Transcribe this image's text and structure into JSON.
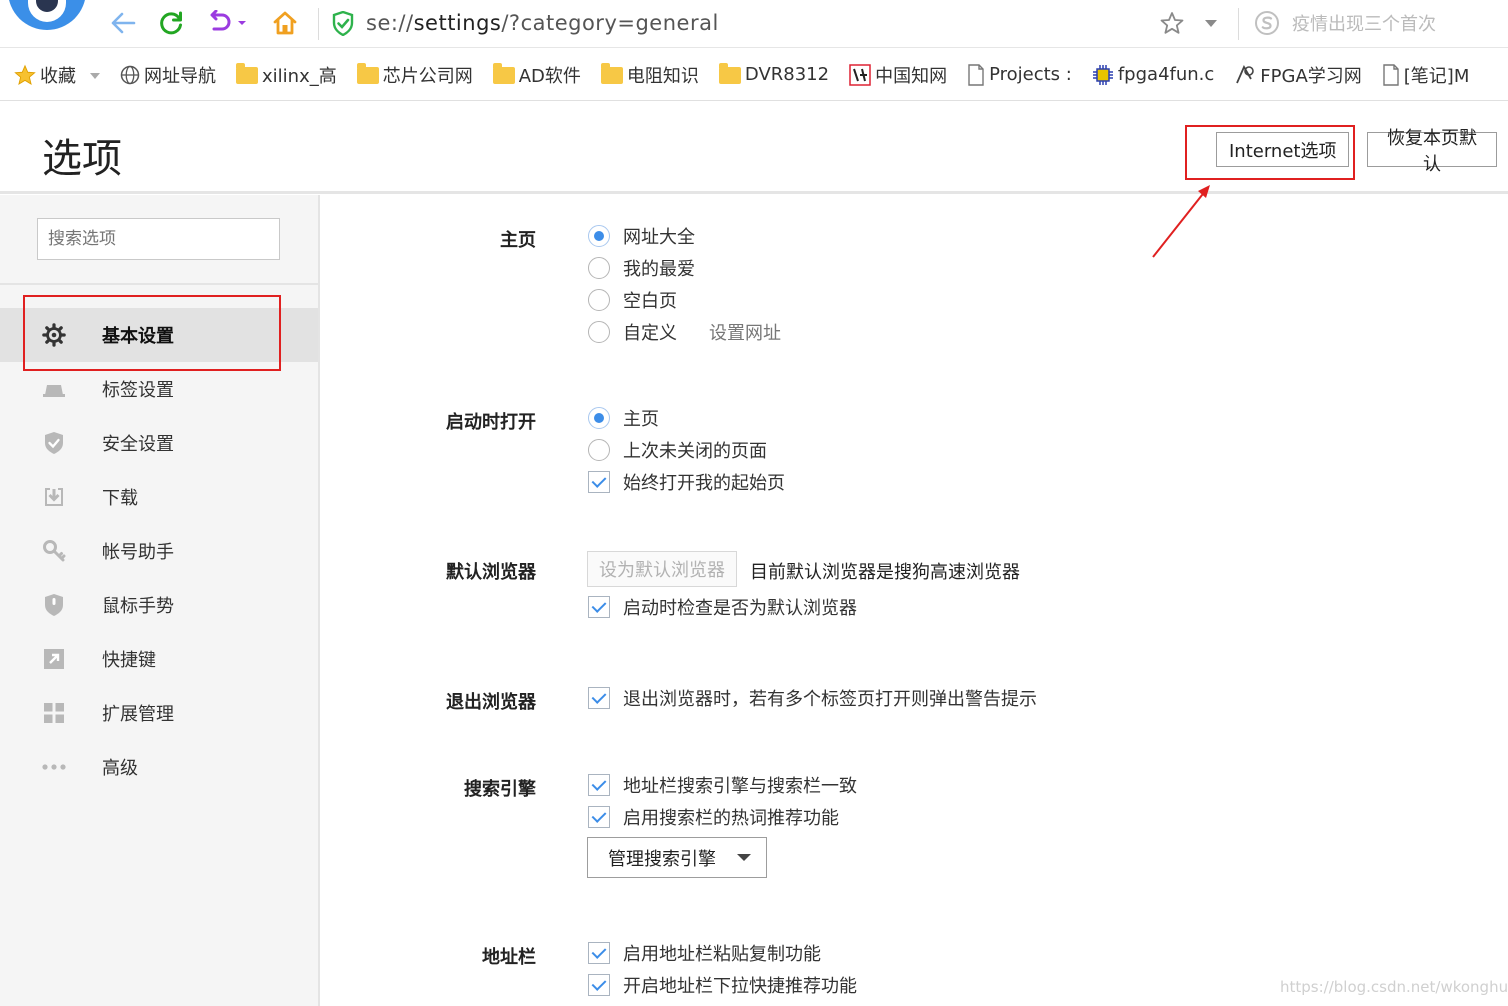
{
  "toolbar": {
    "url_prefix": "se://",
    "url_main": "settings",
    "url_suffix": "/?category=general",
    "search_placeholder": "疫情出现三个首次"
  },
  "bookmarks": [
    {
      "label": "收藏",
      "icon": "star-icon"
    },
    {
      "label": "网址导航",
      "icon": "globe-icon"
    },
    {
      "label": "xilinx_高",
      "icon": "folder-icon"
    },
    {
      "label": "芯片公司网",
      "icon": "folder-icon"
    },
    {
      "label": "AD软件",
      "icon": "folder-icon"
    },
    {
      "label": "电阻知识",
      "icon": "folder-icon"
    },
    {
      "label": "DVR8312",
      "icon": "folder-icon"
    },
    {
      "label": "中国知网",
      "icon": "cnki-icon"
    },
    {
      "label": "Projects :",
      "icon": "page-icon"
    },
    {
      "label": "fpga4fun.c",
      "icon": "chip-icon"
    },
    {
      "label": "FPGA学习网",
      "icon": "fpga-icon"
    },
    {
      "label": "[笔记]M",
      "icon": "page-icon"
    }
  ],
  "header": {
    "title": "选项",
    "internet_options_label": "Internet选项",
    "restore_defaults_label": "恢复本页默认"
  },
  "sidebar": {
    "search_placeholder": "搜索选项",
    "items": [
      {
        "label": "基本设置",
        "icon": "gear-icon",
        "active": true
      },
      {
        "label": "标签设置",
        "icon": "tab-icon"
      },
      {
        "label": "安全设置",
        "icon": "shield-check-icon"
      },
      {
        "label": "下载",
        "icon": "download-icon"
      },
      {
        "label": "帐号助手",
        "icon": "key-icon"
      },
      {
        "label": "鼠标手势",
        "icon": "mouse-icon"
      },
      {
        "label": "快捷键",
        "icon": "shortcut-icon"
      },
      {
        "label": "扩展管理",
        "icon": "extensions-icon"
      },
      {
        "label": "高级",
        "icon": "more-icon"
      }
    ]
  },
  "sections": {
    "homepage": {
      "label": "主页",
      "options": [
        "网址大全",
        "我的最爱",
        "空白页",
        "自定义"
      ],
      "selected": 0,
      "set_url_link": "设置网址"
    },
    "startup": {
      "label": "启动时打开",
      "options": [
        "主页",
        "上次未关闭的页面"
      ],
      "selected": 0,
      "always_open_label": "始终打开我的起始页",
      "always_open_checked": true
    },
    "default_browser": {
      "label": "默认浏览器",
      "set_default_button": "设为默认浏览器",
      "status_text": "目前默认浏览器是搜狗高速浏览器",
      "check_on_startup_label": "启动时检查是否为默认浏览器",
      "check_on_startup_checked": true
    },
    "exit_browser": {
      "label": "退出浏览器",
      "warn_label": "退出浏览器时，若有多个标签页打开则弹出警告提示",
      "warn_checked": true
    },
    "search_engine": {
      "label": "搜索引擎",
      "sync_label": "地址栏搜索引擎与搜索栏一致",
      "sync_checked": true,
      "hotwords_label": "启用搜索栏的热词推荐功能",
      "hotwords_checked": true,
      "manage_button": "管理搜索引擎"
    },
    "address_bar": {
      "label": "地址栏",
      "paste_copy_label": "启用地址栏粘贴复制功能",
      "paste_copy_checked": true,
      "dropdown_label": "开启地址栏下拉快捷推荐功能",
      "dropdown_checked": true
    }
  },
  "watermark": "https://blog.csdn.net/wkonghua",
  "colors": {
    "accent": "#3c8de8",
    "highlight_box": "#e02020",
    "reload": "#22a622",
    "undo": "#9b3be0",
    "home": "#f0a020",
    "secure": "#2eb24c"
  }
}
